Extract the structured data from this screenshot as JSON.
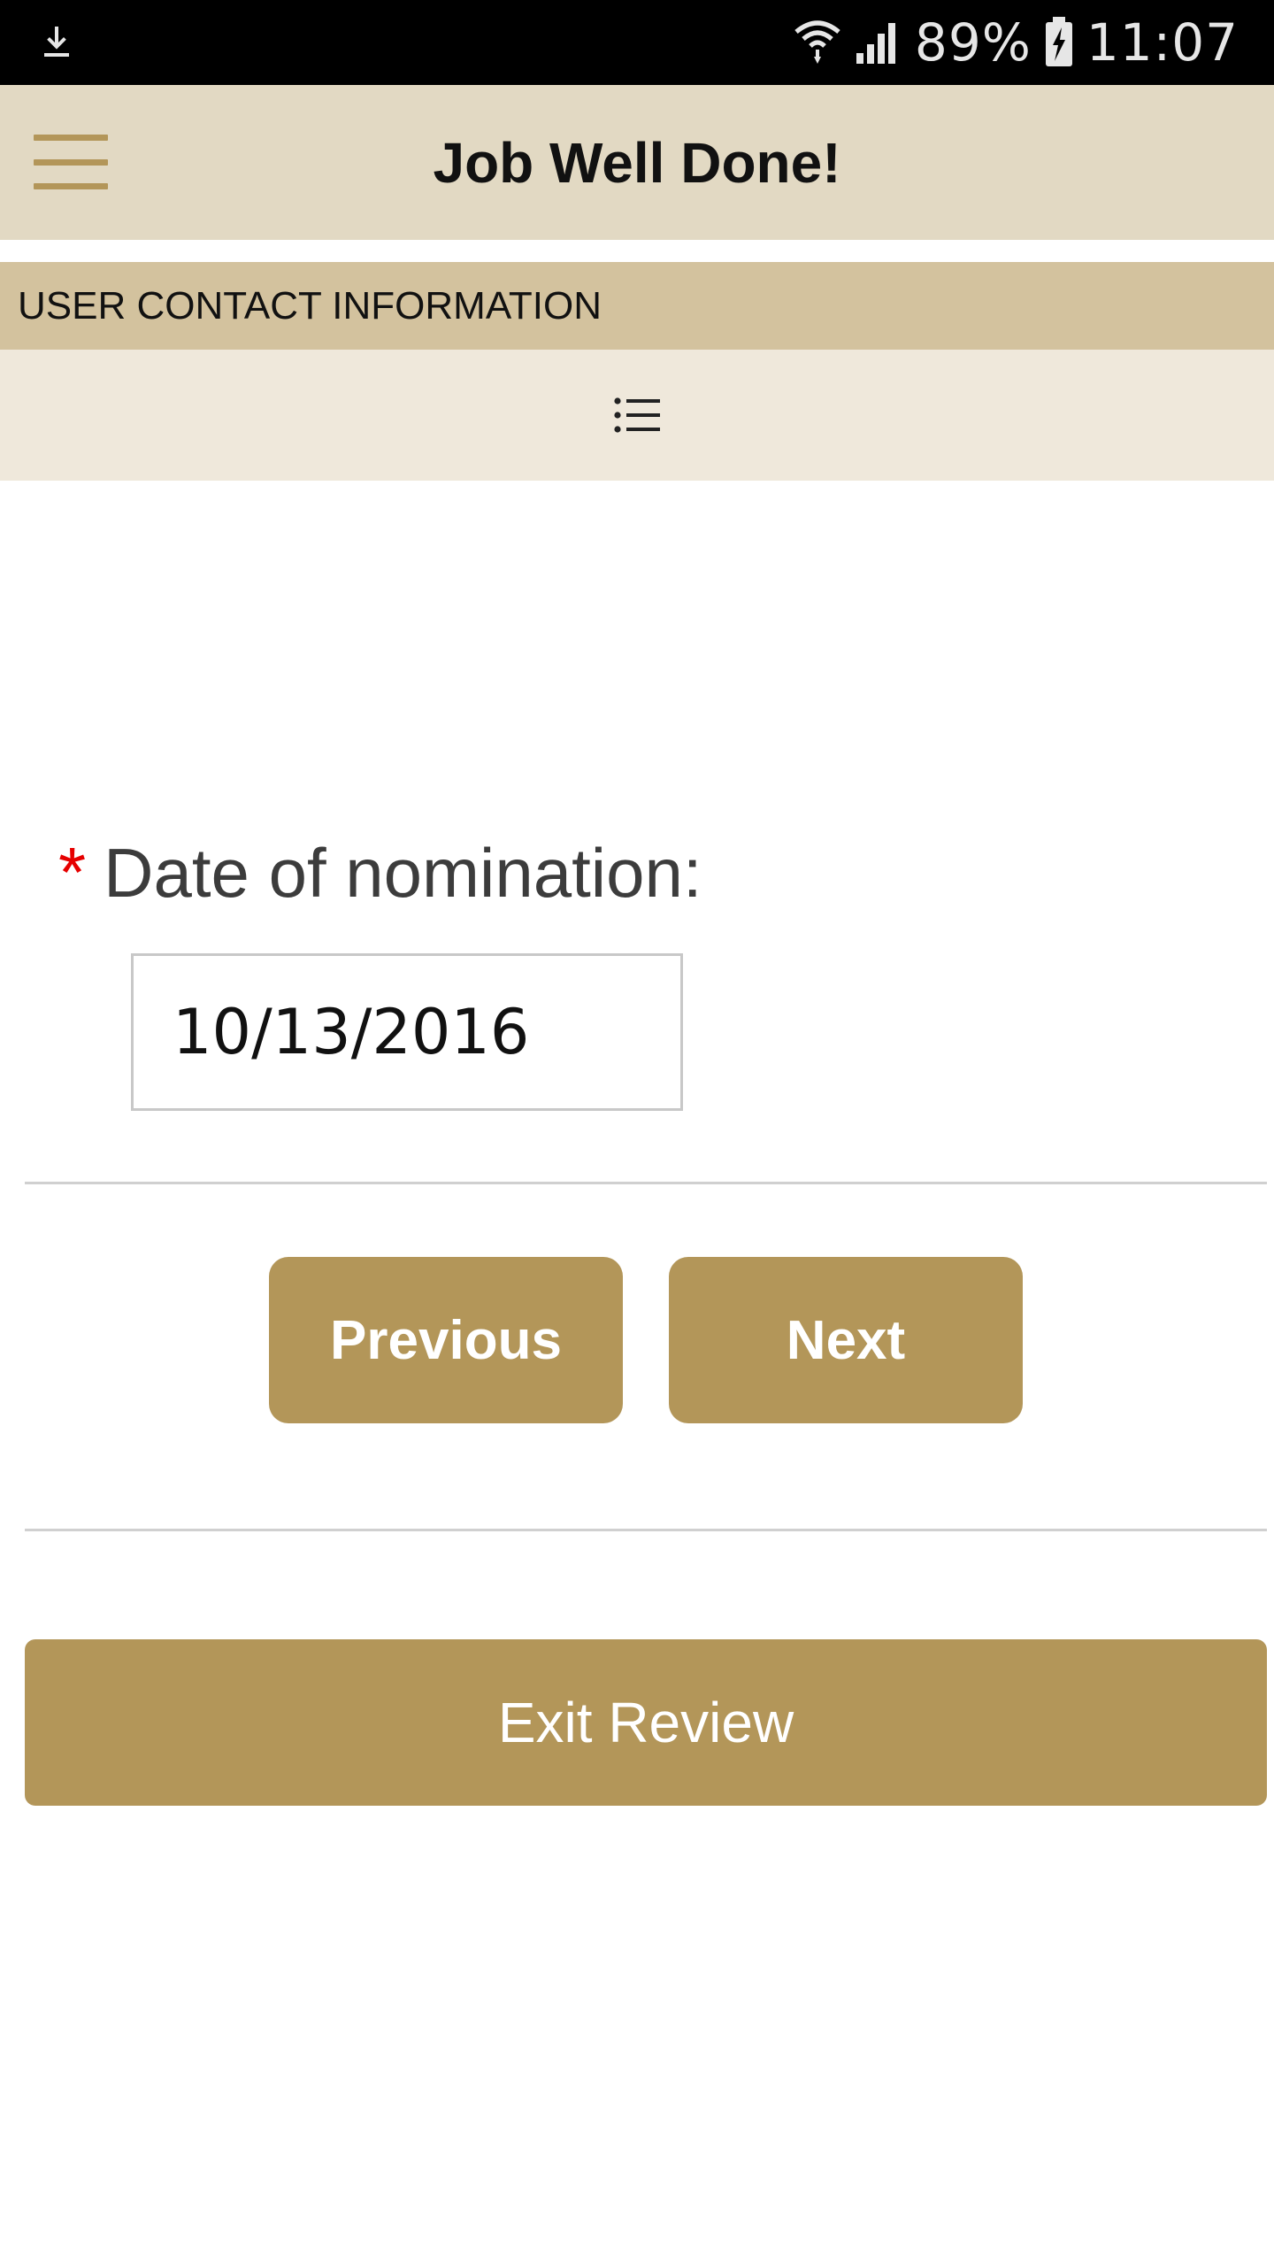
{
  "status_bar": {
    "battery_percent": "89%",
    "time": "11:07",
    "icons": [
      "download-icon",
      "wifi-icon",
      "signal-icon",
      "battery-charging-icon"
    ]
  },
  "app_bar": {
    "title": "Job Well Done!",
    "menu_icon": "hamburger-icon"
  },
  "section": {
    "header": "USER CONTACT INFORMATION",
    "list_icon": "list-icon"
  },
  "form": {
    "required_marker": "*",
    "date_label": "Date of nomination:",
    "date_value": "10/13/2016"
  },
  "navigation": {
    "previous_label": "Previous",
    "next_label": "Next",
    "exit_label": "Exit Review"
  },
  "colors": {
    "accent": "#b39659",
    "app_bar_bg": "#e2d9c3",
    "section_header_bg": "#d3c29e",
    "list_bar_bg": "#efe8db",
    "required": "#e60000"
  }
}
